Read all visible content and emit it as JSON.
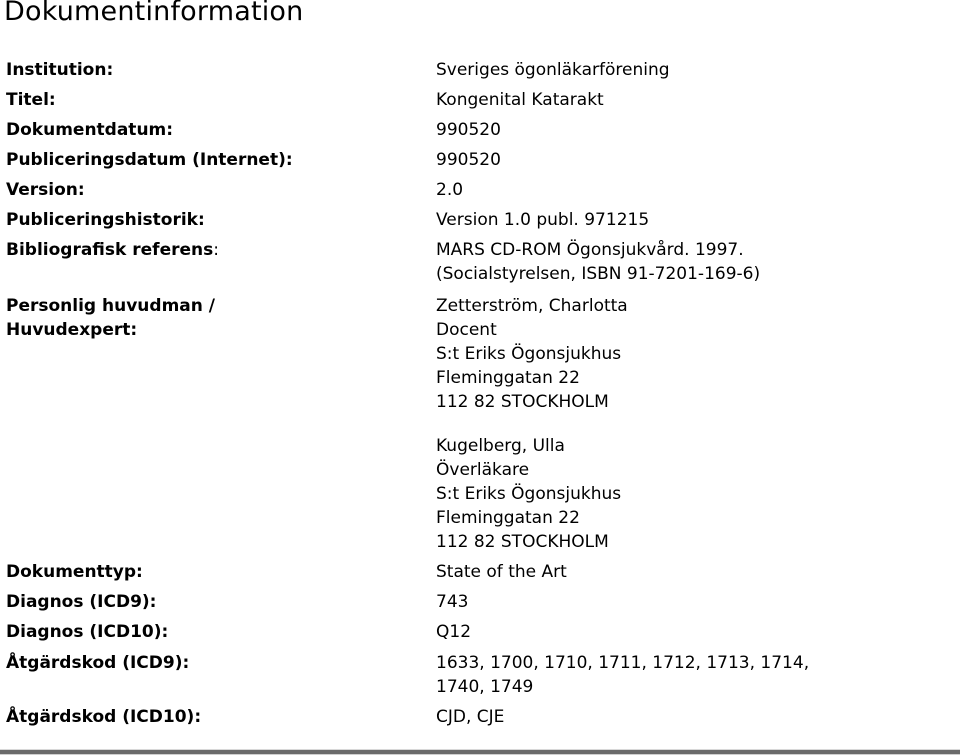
{
  "page_title": "Dokumentinformation",
  "fields": [
    {
      "label": "Institution:",
      "value": [
        "Sveriges ögonläkarförening"
      ]
    },
    {
      "label": "Titel:",
      "value": [
        "Kongenital Katarakt"
      ]
    },
    {
      "label": "Dokumentdatum:",
      "value": [
        "990520"
      ]
    },
    {
      "label": "Publiceringsdatum (Internet):",
      "value": [
        "990520"
      ]
    },
    {
      "label": "Version:",
      "value": [
        "2.0"
      ]
    },
    {
      "label": "Publiceringshistorik:",
      "value": [
        "Version 1.0 publ. 971215"
      ]
    },
    {
      "label_bold": "Bibliografisk referens",
      "label_rest": ":",
      "value": [
        "MARS CD-ROM Ögonsjukvård. 1997.",
        "(Socialstyrelsen, ISBN 91-7201-169-6)"
      ]
    },
    {
      "label_lines": [
        "Personlig huvudman /",
        "Huvudexpert:"
      ],
      "experts": [
        [
          "Zetterström, Charlotta",
          "Docent",
          "S:t Eriks Ögonsjukhus",
          "Fleminggatan 22",
          "112 82 STOCKHOLM"
        ],
        [
          "Kugelberg, Ulla",
          "Överläkare",
          "S:t Eriks Ögonsjukhus",
          "Fleminggatan 22",
          "112 82 STOCKHOLM"
        ]
      ]
    },
    {
      "label": "Dokumenttyp:",
      "value": [
        "State of the Art"
      ]
    },
    {
      "label": "Diagnos (ICD9):",
      "value": [
        "743"
      ]
    },
    {
      "label": "Diagnos (ICD10):",
      "value": [
        "Q12"
      ]
    },
    {
      "label": "Åtgärdskod (ICD9):",
      "value": [
        "1633, 1700, 1710, 1711, 1712, 1713, 1714,",
        "1740, 1749"
      ]
    },
    {
      "label": "Åtgärdskod (ICD10):",
      "value": [
        "CJD, CJE"
      ]
    }
  ]
}
